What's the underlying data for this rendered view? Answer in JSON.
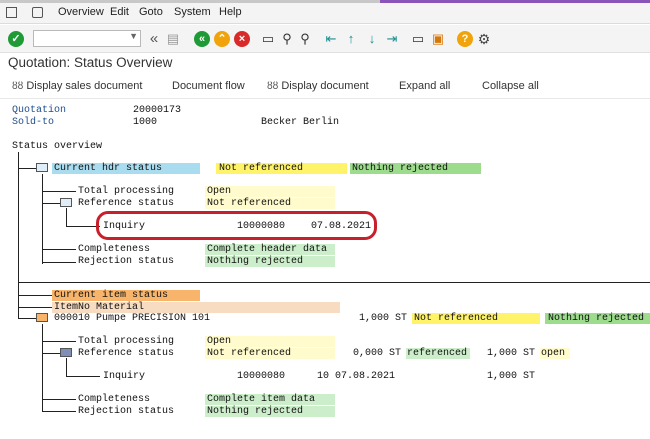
{
  "menu": {
    "items": [
      "Overview",
      "Edit",
      "Goto",
      "System",
      "Help"
    ]
  },
  "toolbar": {
    "icons": [
      "enter-icon",
      "back-icon",
      "exit-icon",
      "cancel-icon",
      "print-icon",
      "find-icon",
      "find-next-icon",
      "first-page-icon",
      "previous-page-icon",
      "next-page-icon",
      "last-page-icon",
      "create-session-icon",
      "shortcut-icon",
      "help-icon",
      "settings-icon"
    ],
    "colors": {
      "green": "#1f9a36",
      "orange": "#f0a30a",
      "red": "#d92a2a",
      "teal": "#1a8f8f"
    }
  },
  "header": {
    "title": "Quotation: Status Overview"
  },
  "app_toolbar": {
    "display_sales_document": "Display sales document",
    "document_flow": "Document flow",
    "display_document": "Display document",
    "expand_all": "Expand all",
    "collapse_all": "Collapse all"
  },
  "document": {
    "quotation_label": "Quotation",
    "quotation_value": "20000173",
    "soldto_label": "Sold-to",
    "soldto_value": "1000",
    "soldto_name": "Becker Berlin"
  },
  "overview": {
    "label": "Status overview",
    "header_status": {
      "label": "Current hdr status",
      "reference": "Not referenced",
      "rejection": "Nothing rejected",
      "total_processing_label": "Total processing",
      "total_processing_value": "Open",
      "reference_status_label": "Reference status",
      "reference_status_value": "Not referenced",
      "inquiry_label": "Inquiry",
      "inquiry_number": "10000080",
      "inquiry_date": "07.08.2021",
      "completeness_label": "Completeness",
      "completeness_value": "Complete header data",
      "rejection_status_label": "Rejection status",
      "rejection_status_value": "Nothing rejected"
    },
    "item_status": {
      "label": "Current item status",
      "columns_label": "ItemNo Material",
      "item_text": "000010 Pumpe PRECISION 101",
      "item_qty": "1,000 ST",
      "item_reference": "Not referenced",
      "item_rejection": "Nothing rejected",
      "total_processing_label": "Total processing",
      "total_processing_value": "Open",
      "reference_status_label": "Reference status",
      "reference_status_value": "Not referenced",
      "ref_qty_1": "0,000 ST",
      "ref_status_1": "referenced",
      "ref_qty_2": "1,000 ST",
      "ref_status_2": "open",
      "inquiry_label": "Inquiry",
      "inquiry_number": "10000080",
      "inquiry_item": "10",
      "inquiry_date": "07.08.2021",
      "inquiry_qty": "1,000 ST",
      "completeness_label": "Completeness",
      "completeness_value": "Complete item data",
      "rejection_status_label": "Rejection status",
      "rejection_status_value": "Nothing rejected"
    }
  }
}
